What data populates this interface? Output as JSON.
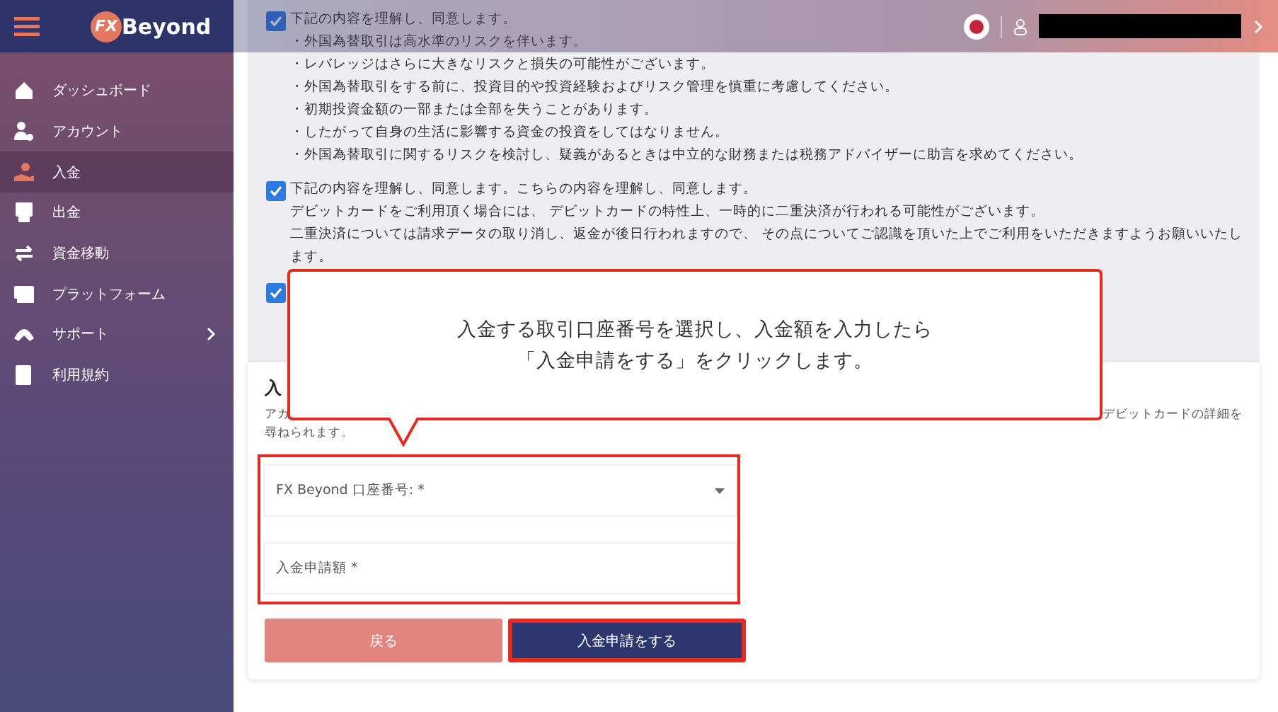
{
  "header": {
    "logo": {
      "mark": "FX",
      "text": "Beyond"
    }
  },
  "sidebar": {
    "items": [
      {
        "label": "ダッシュボード",
        "selected": false,
        "expandable": false
      },
      {
        "label": "アカウント",
        "selected": false,
        "expandable": false
      },
      {
        "label": "入金",
        "selected": true,
        "expandable": false
      },
      {
        "label": "出金",
        "selected": false,
        "expandable": false
      },
      {
        "label": "資金移動",
        "selected": false,
        "expandable": false
      },
      {
        "label": "プラットフォーム",
        "selected": false,
        "expandable": false
      },
      {
        "label": "サポート",
        "selected": false,
        "expandable": true
      },
      {
        "label": "利用規約",
        "selected": false,
        "expandable": false
      }
    ]
  },
  "agreements": [
    {
      "checked": true,
      "lines": [
        "下記の内容を理解し、同意します。",
        "・外国為替取引は高水準のリスクを伴います。",
        "・レバレッジはさらに大きなリスクと損失の可能性がございます。",
        "・外国為替取引をする前に、投資目的や投資経験およびリスク管理を慎重に考慮してください。",
        "・初期投資金額の一部または全部を失うことがあります。",
        "・したがって自身の生活に影響する資金の投資をしてはなりません。",
        "・外国為替取引に関するリスクを検討し、疑義があるときは中立的な財務または税務アドバイザーに助言を求めてください。"
      ]
    },
    {
      "checked": true,
      "lines": [
        "下記の内容を理解し、同意します。こちらの内容を理解し、同意します。",
        "デビットカードをご利用頂く場合には、 デビットカードの特性上、一時的に二重決済が行われる可能性がございます。",
        "二重決済については請求データの取り消し、返金が後日行われますので、 その点についてご認識を頂いた上でご利用をいただきますようお願いいたし",
        "ます。"
      ]
    },
    {
      "checked": true
    }
  ],
  "card": {
    "title": "入",
    "description_left": "アカ",
    "description_right": "デビットカードの詳細を",
    "description_line2": "尋ねられます。",
    "fields_highlighted": true,
    "fields": [
      {
        "kind": "select",
        "placeholder": "FX Beyond 口座番号: *"
      },
      {
        "kind": "input",
        "placeholder": "入金申請額 *"
      }
    ],
    "buttons": [
      {
        "kind": "secondary",
        "label": "戻る",
        "highlighted": false
      },
      {
        "kind": "primary",
        "label": "入金申請をする",
        "highlighted": true
      }
    ]
  },
  "callout": {
    "lines": [
      "入金する取引口座番号を選択し、入金額を入力したら",
      "「入金申請をする」をクリックします。"
    ]
  }
}
